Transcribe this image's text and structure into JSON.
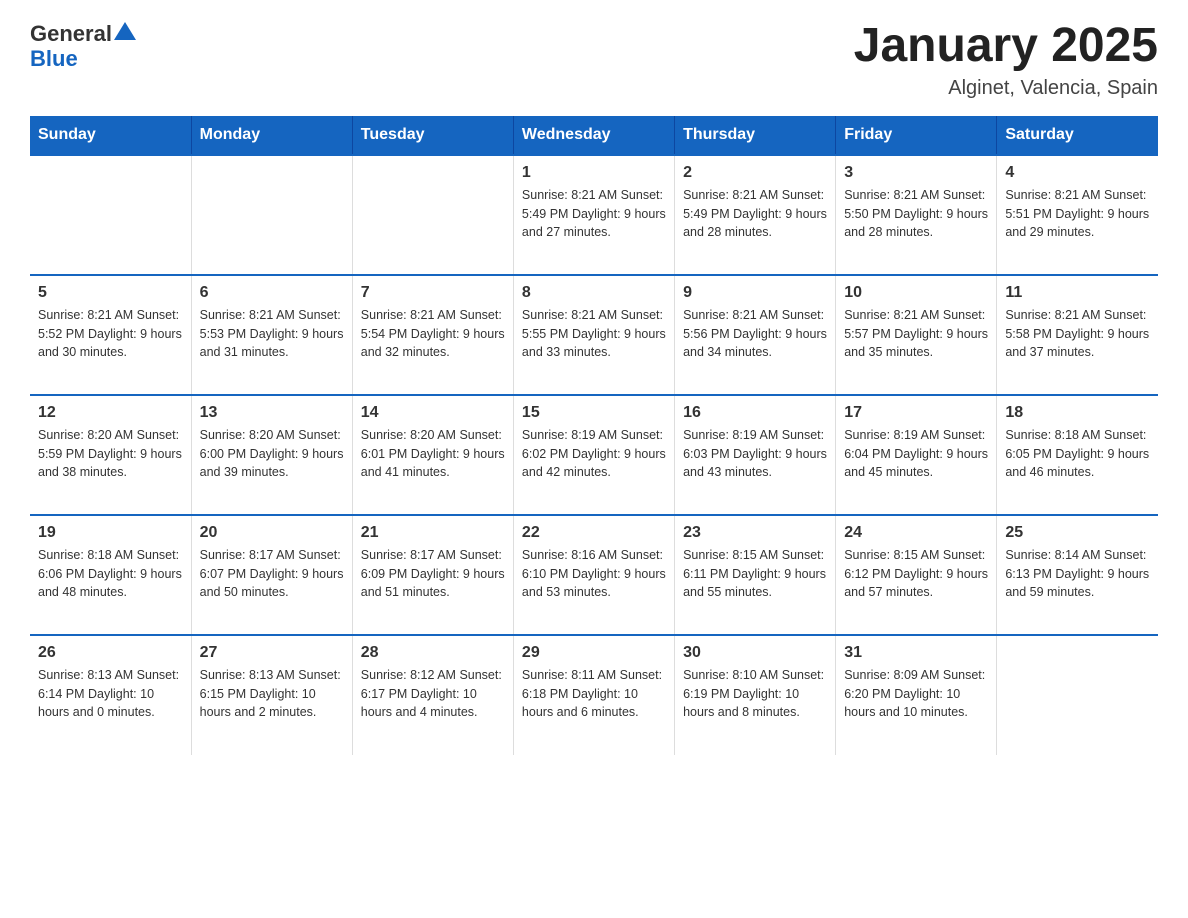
{
  "header": {
    "logo_general": "General",
    "logo_blue": "Blue",
    "calendar_title": "January 2025",
    "calendar_subtitle": "Alginet, Valencia, Spain"
  },
  "weekdays": [
    "Sunday",
    "Monday",
    "Tuesday",
    "Wednesday",
    "Thursday",
    "Friday",
    "Saturday"
  ],
  "weeks": [
    [
      {
        "day": "",
        "info": ""
      },
      {
        "day": "",
        "info": ""
      },
      {
        "day": "",
        "info": ""
      },
      {
        "day": "1",
        "info": "Sunrise: 8:21 AM\nSunset: 5:49 PM\nDaylight: 9 hours\nand 27 minutes."
      },
      {
        "day": "2",
        "info": "Sunrise: 8:21 AM\nSunset: 5:49 PM\nDaylight: 9 hours\nand 28 minutes."
      },
      {
        "day": "3",
        "info": "Sunrise: 8:21 AM\nSunset: 5:50 PM\nDaylight: 9 hours\nand 28 minutes."
      },
      {
        "day": "4",
        "info": "Sunrise: 8:21 AM\nSunset: 5:51 PM\nDaylight: 9 hours\nand 29 minutes."
      }
    ],
    [
      {
        "day": "5",
        "info": "Sunrise: 8:21 AM\nSunset: 5:52 PM\nDaylight: 9 hours\nand 30 minutes."
      },
      {
        "day": "6",
        "info": "Sunrise: 8:21 AM\nSunset: 5:53 PM\nDaylight: 9 hours\nand 31 minutes."
      },
      {
        "day": "7",
        "info": "Sunrise: 8:21 AM\nSunset: 5:54 PM\nDaylight: 9 hours\nand 32 minutes."
      },
      {
        "day": "8",
        "info": "Sunrise: 8:21 AM\nSunset: 5:55 PM\nDaylight: 9 hours\nand 33 minutes."
      },
      {
        "day": "9",
        "info": "Sunrise: 8:21 AM\nSunset: 5:56 PM\nDaylight: 9 hours\nand 34 minutes."
      },
      {
        "day": "10",
        "info": "Sunrise: 8:21 AM\nSunset: 5:57 PM\nDaylight: 9 hours\nand 35 minutes."
      },
      {
        "day": "11",
        "info": "Sunrise: 8:21 AM\nSunset: 5:58 PM\nDaylight: 9 hours\nand 37 minutes."
      }
    ],
    [
      {
        "day": "12",
        "info": "Sunrise: 8:20 AM\nSunset: 5:59 PM\nDaylight: 9 hours\nand 38 minutes."
      },
      {
        "day": "13",
        "info": "Sunrise: 8:20 AM\nSunset: 6:00 PM\nDaylight: 9 hours\nand 39 minutes."
      },
      {
        "day": "14",
        "info": "Sunrise: 8:20 AM\nSunset: 6:01 PM\nDaylight: 9 hours\nand 41 minutes."
      },
      {
        "day": "15",
        "info": "Sunrise: 8:19 AM\nSunset: 6:02 PM\nDaylight: 9 hours\nand 42 minutes."
      },
      {
        "day": "16",
        "info": "Sunrise: 8:19 AM\nSunset: 6:03 PM\nDaylight: 9 hours\nand 43 minutes."
      },
      {
        "day": "17",
        "info": "Sunrise: 8:19 AM\nSunset: 6:04 PM\nDaylight: 9 hours\nand 45 minutes."
      },
      {
        "day": "18",
        "info": "Sunrise: 8:18 AM\nSunset: 6:05 PM\nDaylight: 9 hours\nand 46 minutes."
      }
    ],
    [
      {
        "day": "19",
        "info": "Sunrise: 8:18 AM\nSunset: 6:06 PM\nDaylight: 9 hours\nand 48 minutes."
      },
      {
        "day": "20",
        "info": "Sunrise: 8:17 AM\nSunset: 6:07 PM\nDaylight: 9 hours\nand 50 minutes."
      },
      {
        "day": "21",
        "info": "Sunrise: 8:17 AM\nSunset: 6:09 PM\nDaylight: 9 hours\nand 51 minutes."
      },
      {
        "day": "22",
        "info": "Sunrise: 8:16 AM\nSunset: 6:10 PM\nDaylight: 9 hours\nand 53 minutes."
      },
      {
        "day": "23",
        "info": "Sunrise: 8:15 AM\nSunset: 6:11 PM\nDaylight: 9 hours\nand 55 minutes."
      },
      {
        "day": "24",
        "info": "Sunrise: 8:15 AM\nSunset: 6:12 PM\nDaylight: 9 hours\nand 57 minutes."
      },
      {
        "day": "25",
        "info": "Sunrise: 8:14 AM\nSunset: 6:13 PM\nDaylight: 9 hours\nand 59 minutes."
      }
    ],
    [
      {
        "day": "26",
        "info": "Sunrise: 8:13 AM\nSunset: 6:14 PM\nDaylight: 10 hours\nand 0 minutes."
      },
      {
        "day": "27",
        "info": "Sunrise: 8:13 AM\nSunset: 6:15 PM\nDaylight: 10 hours\nand 2 minutes."
      },
      {
        "day": "28",
        "info": "Sunrise: 8:12 AM\nSunset: 6:17 PM\nDaylight: 10 hours\nand 4 minutes."
      },
      {
        "day": "29",
        "info": "Sunrise: 8:11 AM\nSunset: 6:18 PM\nDaylight: 10 hours\nand 6 minutes."
      },
      {
        "day": "30",
        "info": "Sunrise: 8:10 AM\nSunset: 6:19 PM\nDaylight: 10 hours\nand 8 minutes."
      },
      {
        "day": "31",
        "info": "Sunrise: 8:09 AM\nSunset: 6:20 PM\nDaylight: 10 hours\nand 10 minutes."
      },
      {
        "day": "",
        "info": ""
      }
    ]
  ]
}
